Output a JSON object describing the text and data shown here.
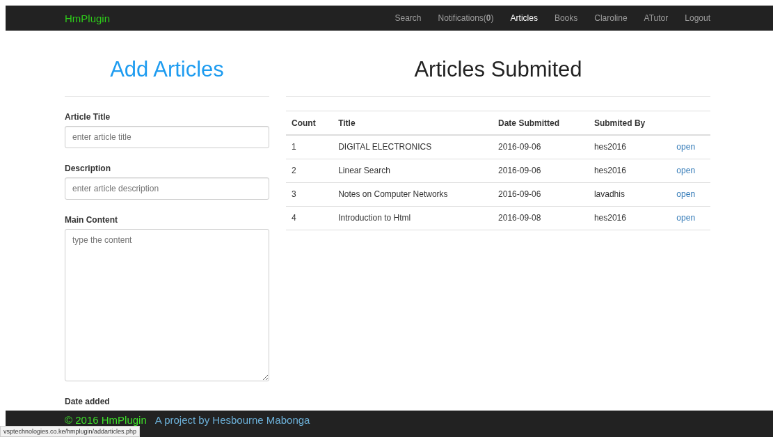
{
  "navbar": {
    "brand": "HmPlugin",
    "items": [
      {
        "label": "Search",
        "selected": false
      },
      {
        "label": "Notifications(**0**)",
        "selected": false
      },
      {
        "label": "Articles",
        "selected": true
      },
      {
        "label": "Books",
        "selected": false
      },
      {
        "label": "Claroline",
        "selected": false
      },
      {
        "label": "ATutor",
        "selected": false
      },
      {
        "label": "Logout",
        "selected": false
      }
    ]
  },
  "form": {
    "heading": "Add Articles",
    "fields": [
      {
        "kind": "input",
        "label": "Article Title",
        "placeholder": "enter article title"
      },
      {
        "kind": "input",
        "label": "Description",
        "placeholder": "enter article description"
      },
      {
        "kind": "textarea",
        "label": "Main Content",
        "placeholder": "type the content"
      },
      {
        "kind": "label",
        "label": "Date added"
      }
    ]
  },
  "articles": {
    "heading": "Articles Submited",
    "columns": [
      "Count",
      "Title",
      "Date Submitted",
      "Submited By"
    ],
    "rows": [
      {
        "cells": [
          "1",
          "DIGITAL ELECTRONICS",
          "2016-09-06",
          "hes2016"
        ],
        "link": "open"
      },
      {
        "cells": [
          "2",
          "Linear Search",
          "2016-09-06",
          "hes2016"
        ],
        "link": "open"
      },
      {
        "cells": [
          "3",
          "Notes on Computer Networks",
          "2016-09-06",
          "lavadhis"
        ],
        "link": "open"
      },
      {
        "cells": [
          "4",
          "Introduction to Html",
          "2016-09-08",
          "hes2016"
        ],
        "link": "open"
      }
    ]
  },
  "footer": {
    "copyright": "© 2016 HmPlugin",
    "credit": "A project by Hesbourne Mabonga"
  },
  "status_url": "vsptechnologies.co.ke/hmplugin/addarticles.php"
}
